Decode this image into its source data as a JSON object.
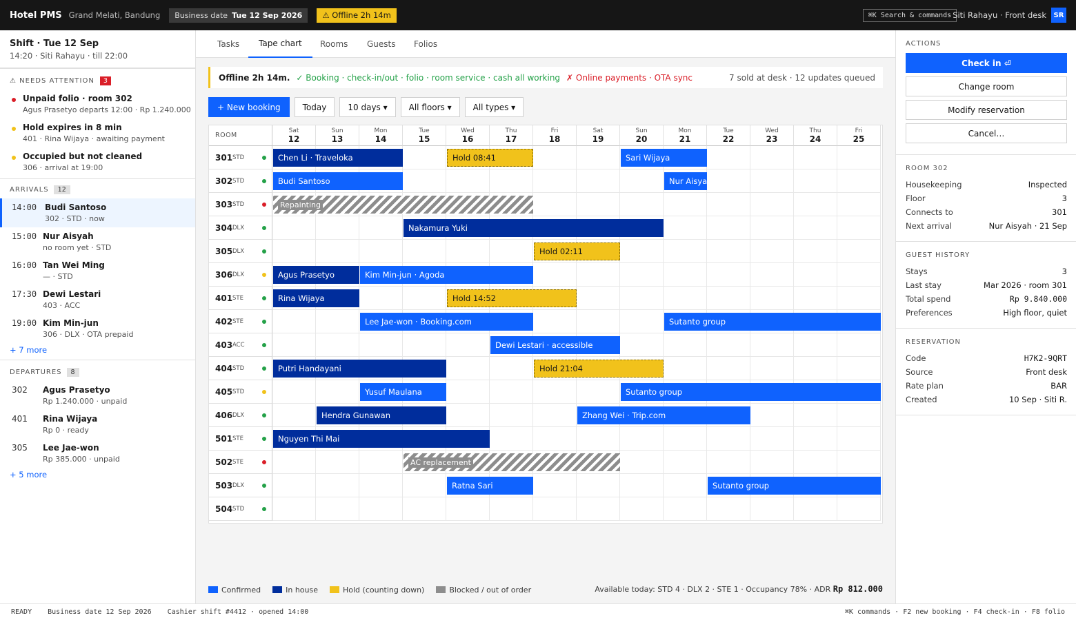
{
  "topbar": {
    "app_title": "Hotel PMS",
    "property": "Grand Melati, Bandung",
    "business_date_label": "Business date",
    "business_date": "Tue 12 Sep 2026",
    "offline": "⚠ Offline 2h 14m",
    "command_hint": "⌘K Search & commands",
    "user": "Siti Rahayu · Front desk",
    "avatar": "SR"
  },
  "shift": {
    "title": "Shift · Tue 12 Sep",
    "subtitle": "14:20 · Siti Rahayu · till 22:00"
  },
  "attention": {
    "label": "⚠ NEEDS ATTENTION",
    "count": "3",
    "items": [
      {
        "title": "Unpaid folio · room 302",
        "sub": "Agus Prasetyo departs 12:00 · Rp 1.240.000",
        "color": "#da1e28"
      },
      {
        "title": "Hold expires in 8 min",
        "sub": "401 · Rina Wijaya · awaiting payment",
        "color": "#f1c21b"
      },
      {
        "title": "Occupied but not cleaned",
        "sub": "306 · arrival at 19:00",
        "color": "#f1c21b"
      }
    ]
  },
  "arrivals": {
    "label": "ARRIVALS",
    "count": "12",
    "items": [
      {
        "time": "14:00",
        "name": "Budi Santoso",
        "sub": "302 · STD · now"
      },
      {
        "time": "15:00",
        "name": "Nur Aisyah",
        "sub": "no room yet · STD"
      },
      {
        "time": "16:00",
        "name": "Tan Wei Ming",
        "sub": "— · STD"
      },
      {
        "time": "17:30",
        "name": "Dewi Lestari",
        "sub": "403 · ACC"
      },
      {
        "time": "19:00",
        "name": "Kim Min-jun",
        "sub": "306 · DLX · OTA prepaid"
      }
    ],
    "more": "+ 7 more"
  },
  "departures": {
    "label": "DEPARTURES",
    "count": "8",
    "items": [
      {
        "room": "302",
        "name": "Agus Prasetyo",
        "sub": "Rp 1.240.000 · unpaid"
      },
      {
        "room": "401",
        "name": "Rina Wijaya",
        "sub": "Rp 0 · ready"
      },
      {
        "room": "305",
        "name": "Lee Jae-won",
        "sub": "Rp 385.000 · unpaid"
      }
    ],
    "more": "+ 5 more"
  },
  "tabs": [
    "Tasks",
    "Tape chart",
    "Rooms",
    "Guests",
    "Folios"
  ],
  "active_tab": "Tape chart",
  "banner": {
    "title": "Offline 2h 14m.",
    "ok": "✓ Booking · check-in/out · folio · room service · cash all working",
    "bad": "✗ Online payments · OTA sync",
    "queue": "7 sold at desk · 12 updates queued"
  },
  "toolbar": {
    "new_booking": "+ New booking",
    "today": "Today",
    "range": "10 days ▾",
    "floors": "All floors ▾",
    "types": "All types ▾"
  },
  "tape": {
    "room_header": "ROOM",
    "days": [
      {
        "dn": "Sat",
        "dd": "12"
      },
      {
        "dn": "Sun",
        "dd": "13"
      },
      {
        "dn": "Mon",
        "dd": "14"
      },
      {
        "dn": "Tue",
        "dd": "15"
      },
      {
        "dn": "Wed",
        "dd": "16"
      },
      {
        "dn": "Thu",
        "dd": "17"
      },
      {
        "dn": "Fri",
        "dd": "18"
      },
      {
        "dn": "Sat",
        "dd": "19"
      },
      {
        "dn": "Sun",
        "dd": "20"
      },
      {
        "dn": "Mon",
        "dd": "21"
      },
      {
        "dn": "Tue",
        "dd": "22"
      },
      {
        "dn": "Wed",
        "dd": "23"
      },
      {
        "dn": "Thu",
        "dd": "24"
      },
      {
        "dn": "Fri",
        "dd": "25"
      }
    ],
    "rooms": [
      {
        "no": "301",
        "type": "STD",
        "status": "#24a148"
      },
      {
        "no": "302",
        "type": "STD",
        "status": "#24a148"
      },
      {
        "no": "303",
        "type": "STD",
        "status": "#da1e28"
      },
      {
        "no": "304",
        "type": "DLX",
        "status": "#24a148"
      },
      {
        "no": "305",
        "type": "DLX",
        "status": "#24a148"
      },
      {
        "no": "306",
        "type": "DLX",
        "status": "#f1c21b"
      },
      {
        "no": "401",
        "type": "STE",
        "status": "#24a148"
      },
      {
        "no": "402",
        "type": "STE",
        "status": "#24a148"
      },
      {
        "no": "403",
        "type": "ACC",
        "status": "#24a148"
      },
      {
        "no": "404",
        "type": "STD",
        "status": "#24a148"
      },
      {
        "no": "405",
        "type": "STD",
        "status": "#f1c21b"
      },
      {
        "no": "406",
        "type": "DLX",
        "status": "#24a148"
      },
      {
        "no": "501",
        "type": "STE",
        "status": "#24a148"
      },
      {
        "no": "502",
        "type": "STE",
        "status": "#da1e28"
      },
      {
        "no": "503",
        "type": "DLX",
        "status": "#24a148"
      },
      {
        "no": "504",
        "type": "STD",
        "status": "#24a148"
      }
    ],
    "bookings": [
      {
        "room": 0,
        "start": 0,
        "nights": 3,
        "kind": "inhouse",
        "label": "Chen Li · Traveloka"
      },
      {
        "room": 0,
        "start": 4,
        "nights": 2,
        "kind": "hold",
        "label": "Hold 08:41"
      },
      {
        "room": 0,
        "start": 8,
        "nights": 2,
        "kind": "confirmed",
        "label": "Sari Wijaya"
      },
      {
        "room": 1,
        "start": 0,
        "nights": 3,
        "kind": "confirmed",
        "label": "Budi Santoso"
      },
      {
        "room": 1,
        "start": 9,
        "nights": 1,
        "kind": "confirmed",
        "label": "Nur Aisyah"
      },
      {
        "room": 2,
        "start": 0,
        "nights": 6,
        "kind": "blocked",
        "label": "Repainting"
      },
      {
        "room": 3,
        "start": 3,
        "nights": 6,
        "kind": "inhouse",
        "label": "Nakamura Yuki"
      },
      {
        "room": 4,
        "start": 6,
        "nights": 2,
        "kind": "hold",
        "label": "Hold 02:11"
      },
      {
        "room": 5,
        "start": 0,
        "nights": 2,
        "kind": "inhouse",
        "label": "Agus Prasetyo"
      },
      {
        "room": 5,
        "start": 2,
        "nights": 4,
        "kind": "confirmed",
        "label": "Kim Min-jun · Agoda"
      },
      {
        "room": 6,
        "start": 0,
        "nights": 2,
        "kind": "inhouse",
        "label": "Rina Wijaya"
      },
      {
        "room": 6,
        "start": 4,
        "nights": 3,
        "kind": "hold",
        "label": "Hold 14:52"
      },
      {
        "room": 7,
        "start": 2,
        "nights": 4,
        "kind": "confirmed",
        "label": "Lee Jae-won · Booking.com"
      },
      {
        "room": 7,
        "start": 9,
        "nights": 5,
        "kind": "confirmed",
        "label": "Sutanto group"
      },
      {
        "room": 8,
        "start": 5,
        "nights": 3,
        "kind": "confirmed",
        "label": "Dewi Lestari · accessible"
      },
      {
        "room": 9,
        "start": 0,
        "nights": 4,
        "kind": "inhouse",
        "label": "Putri Handayani"
      },
      {
        "room": 9,
        "start": 6,
        "nights": 3,
        "kind": "hold",
        "label": "Hold 21:04"
      },
      {
        "room": 10,
        "start": 2,
        "nights": 2,
        "kind": "confirmed",
        "label": "Yusuf Maulana"
      },
      {
        "room": 10,
        "start": 8,
        "nights": 6,
        "kind": "confirmed",
        "label": "Sutanto group"
      },
      {
        "room": 11,
        "start": 1,
        "nights": 3,
        "kind": "inhouse",
        "label": "Hendra Gunawan"
      },
      {
        "room": 11,
        "start": 7,
        "nights": 4,
        "kind": "confirmed",
        "label": "Zhang Wei · Trip.com"
      },
      {
        "room": 12,
        "start": 0,
        "nights": 5,
        "kind": "inhouse",
        "label": "Nguyen Thi Mai"
      },
      {
        "room": 13,
        "start": 3,
        "nights": 5,
        "kind": "blocked",
        "label": "AC replacement"
      },
      {
        "room": 14,
        "start": 4,
        "nights": 2,
        "kind": "confirmed",
        "label": "Ratna Sari"
      },
      {
        "room": 14,
        "start": 10,
        "nights": 4,
        "kind": "confirmed",
        "label": "Sutanto group"
      }
    ]
  },
  "legend": {
    "confirmed": "Confirmed",
    "inhouse": "In house",
    "hold": "Hold (counting down)",
    "blocked": "Blocked / out of order",
    "colors": {
      "confirmed": "#0f62fe",
      "inhouse": "#002d9c",
      "hold": "#f1c21b",
      "blocked": "#8d8d8d"
    }
  },
  "availability": {
    "text": "Available today: STD 4 · DLX 2 · STE 1  ·  Occupancy 78% · ADR",
    "adr": "Rp 812.000"
  },
  "actions": {
    "label": "ACTIONS",
    "check_in": "Check in ⏎",
    "change_room": "Change room",
    "modify": "Modify reservation",
    "cancel": "Cancel…"
  },
  "room_info": {
    "label": "ROOM 302",
    "rows": [
      {
        "k": "Housekeeping",
        "v": "Inspected"
      },
      {
        "k": "Floor",
        "v": "3"
      },
      {
        "k": "Connects to",
        "v": "301"
      },
      {
        "k": "Next arrival",
        "v": "Nur Aisyah · 21 Sep"
      }
    ]
  },
  "guest_history": {
    "label": "GUEST HISTORY",
    "rows": [
      {
        "k": "Stays",
        "v": "3"
      },
      {
        "k": "Last stay",
        "v": "Mar 2026 · room 301"
      },
      {
        "k": "Total spend",
        "v": "Rp 9.840.000"
      },
      {
        "k": "Preferences",
        "v": "High floor, quiet"
      }
    ]
  },
  "reservation": {
    "label": "RESERVATION",
    "rows": [
      {
        "k": "Code",
        "v": "H7K2-9QRT"
      },
      {
        "k": "Source",
        "v": "Front desk"
      },
      {
        "k": "Rate plan",
        "v": "BAR"
      },
      {
        "k": "Created",
        "v": "10 Sep · Siti R."
      }
    ]
  },
  "statusbar": {
    "ready": "READY",
    "bizdate": "Business date 12 Sep 2026",
    "shift": "Cashier shift #4412 · opened 14:00",
    "keys": "⌘K commands · F2 new booking · F4 check-in · F8 folio"
  }
}
